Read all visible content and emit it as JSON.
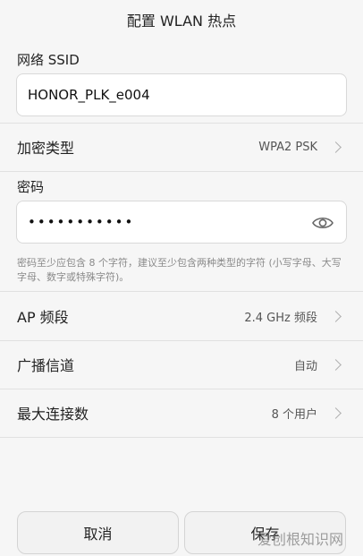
{
  "title": "配置 WLAN 热点",
  "ssid": {
    "label": "网络 SSID",
    "value": "HONOR_PLK_e004"
  },
  "encryption": {
    "label": "加密类型",
    "value": "WPA2 PSK"
  },
  "password": {
    "label": "密码",
    "value": "•••••••••••",
    "hint": "密码至少应包含 8 个字符，建议至少包含两种类型的字符 (小写字母、大写字母、数字或特殊字符)。"
  },
  "band": {
    "label": "AP 频段",
    "value": "2.4 GHz 频段"
  },
  "channel": {
    "label": "广播信道",
    "value": "自动"
  },
  "max_connections": {
    "label": "最大连接数",
    "value": "8 个用户"
  },
  "buttons": {
    "cancel": "取消",
    "save": "保存"
  },
  "watermark": "爱创根知识网",
  "icons": {
    "eye": "eye-icon",
    "chevron": "chevron-right-icon"
  }
}
